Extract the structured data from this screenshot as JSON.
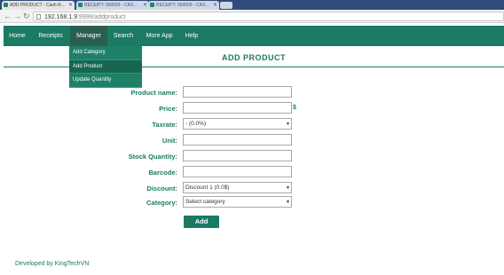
{
  "browser": {
    "tabs": [
      {
        "label": "ADD PRODUCT - Cash R…"
      },
      {
        "label": "RECEIPT: 000003 - CAS…"
      },
      {
        "label": "RECEIPT: 000003 - CAS…"
      }
    ],
    "url_host": "192.168.1.9",
    "url_port": ":9999",
    "url_path": "/addproduct"
  },
  "nav": {
    "items": [
      {
        "label": "Home"
      },
      {
        "label": "Receipts"
      },
      {
        "label": "Manager"
      },
      {
        "label": "Search"
      },
      {
        "label": "More App"
      },
      {
        "label": "Help"
      }
    ],
    "dropdown": [
      {
        "label": "Add Category"
      },
      {
        "label": "Add Product"
      },
      {
        "label": "Update Quantity"
      }
    ]
  },
  "page": {
    "title": "ADD PRODUCT"
  },
  "form": {
    "product_name": {
      "label": "Product name:",
      "value": ""
    },
    "price": {
      "label": "Price:",
      "value": "",
      "unit": "$"
    },
    "taxrate": {
      "label": "Taxrate:",
      "selected": "- (0.0%)"
    },
    "unit": {
      "label": "Unit:",
      "value": ""
    },
    "stock_quantity": {
      "label": "Stock Quantity:",
      "value": ""
    },
    "barcode": {
      "label": "Barcode:",
      "value": ""
    },
    "discount": {
      "label": "Discount:",
      "selected": "Discount 1 (0.0$)"
    },
    "category": {
      "label": "Category:",
      "selected": "Select category"
    },
    "submit_label": "Add"
  },
  "footer": {
    "text": "Developed by KingTechVN"
  },
  "colors": {
    "accent": "#1a7a63",
    "nav_active": "#2b5e50"
  }
}
